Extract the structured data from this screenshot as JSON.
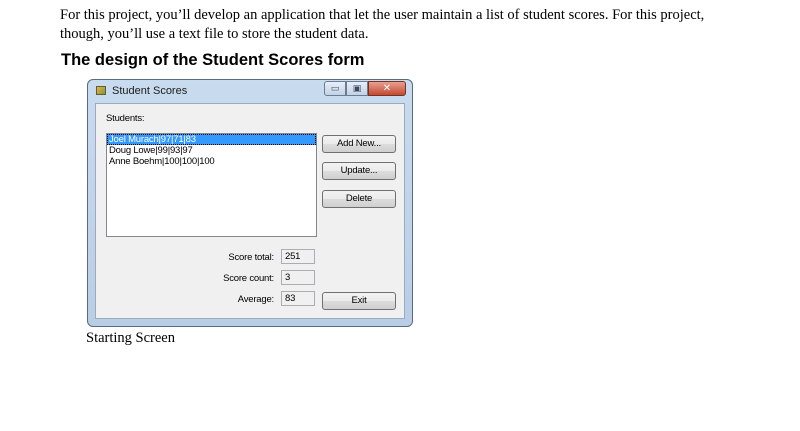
{
  "intro_text": "For this project, you’ll develop an application that let the user maintain a list of student scores. For this project, though, you’ll use a text file to store the student data.",
  "heading": "The design of the Student Scores form",
  "caption": "Starting Screen",
  "window": {
    "title": "Student Scores",
    "minimize_glyph": "▭",
    "maximize_glyph": "▣",
    "close_glyph": "✕"
  },
  "form": {
    "students_label": "Students:",
    "students": [
      "Joel Murach|97|71|83",
      "Doug Lowe|99|93|97",
      "Anne Boehm|100|100|100"
    ],
    "selected_index": 0,
    "buttons": {
      "add_new": "Add New...",
      "update": "Update...",
      "delete": "Delete",
      "exit": "Exit"
    },
    "score_total_label": "Score total:",
    "score_total": "251",
    "score_count_label": "Score count:",
    "score_count": "3",
    "average_label": "Average:",
    "average": "83"
  }
}
